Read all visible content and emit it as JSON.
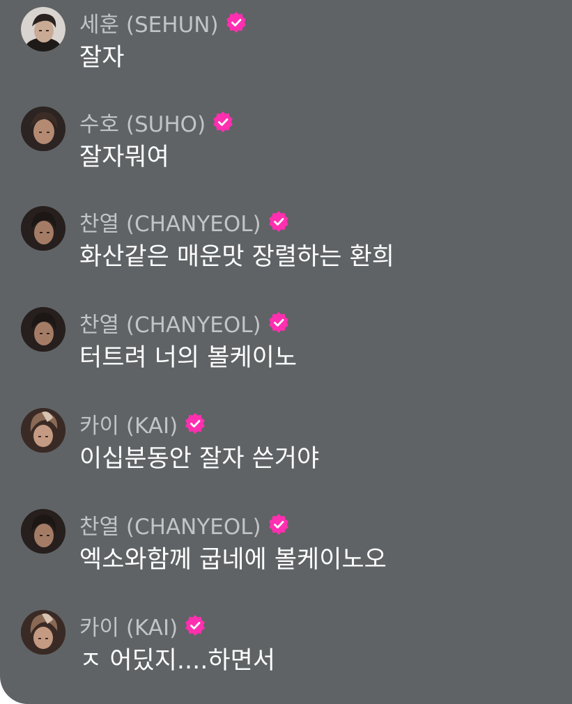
{
  "colors": {
    "panel_background": "#5f6366",
    "username_text": "#c2c4c6",
    "message_text": "#ffffff",
    "verified_badge": "#ff2fb0"
  },
  "messages": [
    {
      "name": "세훈 (SEHUN)",
      "text": "잘자",
      "avatar_icon": "avatar-sehun",
      "badge_icon": "verified-badge-icon"
    },
    {
      "name": "수호 (SUHO)",
      "text": "잘자뭐여",
      "avatar_icon": "avatar-suho",
      "badge_icon": "verified-badge-icon"
    },
    {
      "name": "찬열 (CHANYEOL)",
      "text": "화산같은 매운맛 장렬하는 환희",
      "avatar_icon": "avatar-chanyeol",
      "badge_icon": "verified-badge-icon"
    },
    {
      "name": "찬열 (CHANYEOL)",
      "text": "터트려 너의 볼케이노",
      "avatar_icon": "avatar-chanyeol",
      "badge_icon": "verified-badge-icon"
    },
    {
      "name": "카이 (KAI)",
      "text": "이십분동안 잘자 쓴거야",
      "avatar_icon": "avatar-kai",
      "badge_icon": "verified-badge-icon"
    },
    {
      "name": "찬열 (CHANYEOL)",
      "text": "엑소와함께 굽네에 볼케이노오",
      "avatar_icon": "avatar-chanyeol",
      "badge_icon": "verified-badge-icon"
    },
    {
      "name": "카이 (KAI)",
      "text": "ㅈ 어딨지....하면서",
      "avatar_icon": "avatar-kai",
      "badge_icon": "verified-badge-icon"
    }
  ]
}
